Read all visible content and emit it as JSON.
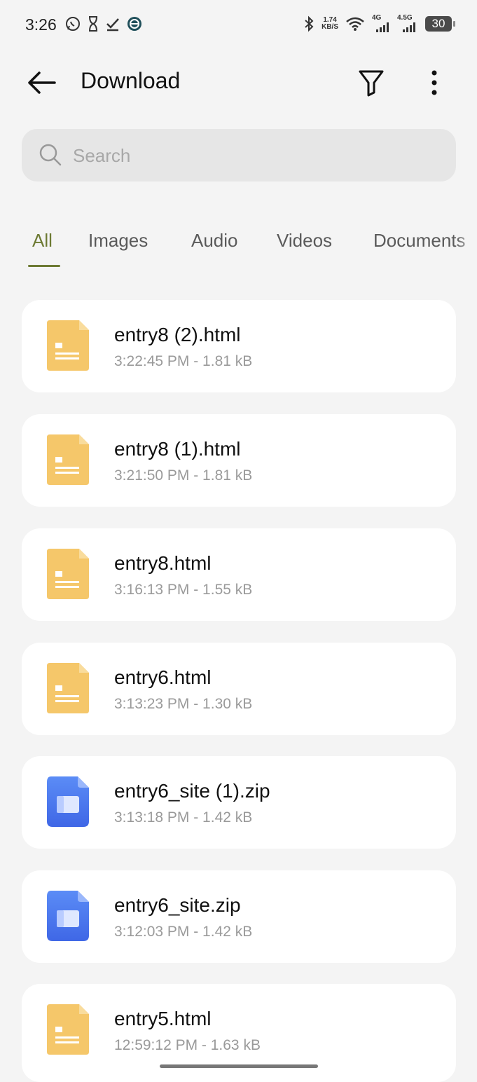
{
  "status_bar": {
    "time": "3:26",
    "net_speed_value": "1.74",
    "net_speed_unit": "KB/S",
    "signal1_label": "4G",
    "signal2_label": "4.5G",
    "battery": "30"
  },
  "appbar": {
    "title": "Download"
  },
  "search": {
    "placeholder": "Search",
    "value": ""
  },
  "tabs": [
    {
      "label": "All",
      "active": true
    },
    {
      "label": "Images",
      "active": false
    },
    {
      "label": "Audio",
      "active": false
    },
    {
      "label": "Videos",
      "active": false
    },
    {
      "label": "Documents",
      "active": false
    }
  ],
  "files": [
    {
      "name": "entry8 (2).html",
      "meta": "3:22:45 PM - 1.81 kB",
      "type": "html"
    },
    {
      "name": "entry8 (1).html",
      "meta": "3:21:50 PM - 1.81 kB",
      "type": "html"
    },
    {
      "name": "entry8.html",
      "meta": "3:16:13 PM - 1.55 kB",
      "type": "html"
    },
    {
      "name": "entry6.html",
      "meta": "3:13:23 PM - 1.30 kB",
      "type": "html"
    },
    {
      "name": "entry6_site (1).zip",
      "meta": "3:13:18 PM - 1.42 kB",
      "type": "zip"
    },
    {
      "name": "entry6_site.zip",
      "meta": "3:12:03 PM - 1.42 kB",
      "type": "zip"
    },
    {
      "name": "entry5.html",
      "meta": "12:59:12 PM - 1.63 kB",
      "type": "html"
    }
  ],
  "colors": {
    "accent": "#6d7a33",
    "html_icon": "#f5c76a",
    "zip_icon": "#4a78f0"
  }
}
